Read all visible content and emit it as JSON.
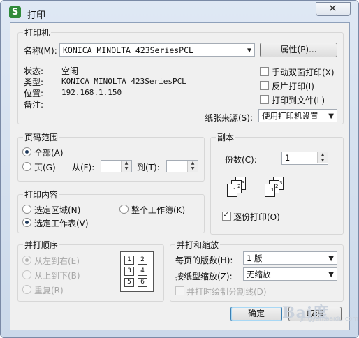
{
  "window": {
    "app_icon_letter": "S",
    "title": "打印",
    "close_glyph": "✕"
  },
  "printer": {
    "legend": "打印机",
    "name_label": "名称(M):",
    "name_value": "KONICA MINOLTA 423SeriesPCL",
    "properties_button": "属性(P)...",
    "status_label": "状态:",
    "status_value": "空闲",
    "type_label": "类型:",
    "type_value": "KONICA MINOLTA 423SeriesPCL",
    "location_label": "位置:",
    "location_value": "192.168.1.150",
    "comment_label": "备注:",
    "manual_duplex": "手动双面打印(X)",
    "reverse_print": "反片打印(I)",
    "print_to_file": "打印到文件(L)",
    "paper_source_label": "纸张来源(S):",
    "paper_source_value": "使用打印机设置"
  },
  "page_range": {
    "legend": "页码范围",
    "all": "全部(A)",
    "pages": "页(G)",
    "from_label": "从(F):",
    "to_label": "到(T):"
  },
  "copies": {
    "legend": "副本",
    "count_label": "份数(C):",
    "count_value": "1",
    "collate": "逐份打印(O)"
  },
  "print_what": {
    "legend": "打印内容",
    "selection": "选定区域(N)",
    "entire_workbook": "整个工作簿(K)",
    "active_sheets": "选定工作表(V)"
  },
  "print_order": {
    "legend": "并打顺序",
    "left_to_right": "从左到右(E)",
    "top_to_bottom": "从上到下(B)",
    "repeat": "重复(R)",
    "cells": [
      "1",
      "2",
      "3",
      "4",
      "5",
      "6"
    ]
  },
  "scaling": {
    "legend": "并打和缩放",
    "pages_per_sheet_label": "每页的版数(H):",
    "pages_per_sheet_value": "1 版",
    "scale_label": "按纸型缩放(Z):",
    "scale_value": "无缩放",
    "draw_borders": "并打时绘制分割线(D)"
  },
  "buttons": {
    "ok": "确定",
    "cancel": "取消"
  },
  "watermark": {
    "text": "Bai度",
    "sub": "jingyan.baidu.com"
  }
}
